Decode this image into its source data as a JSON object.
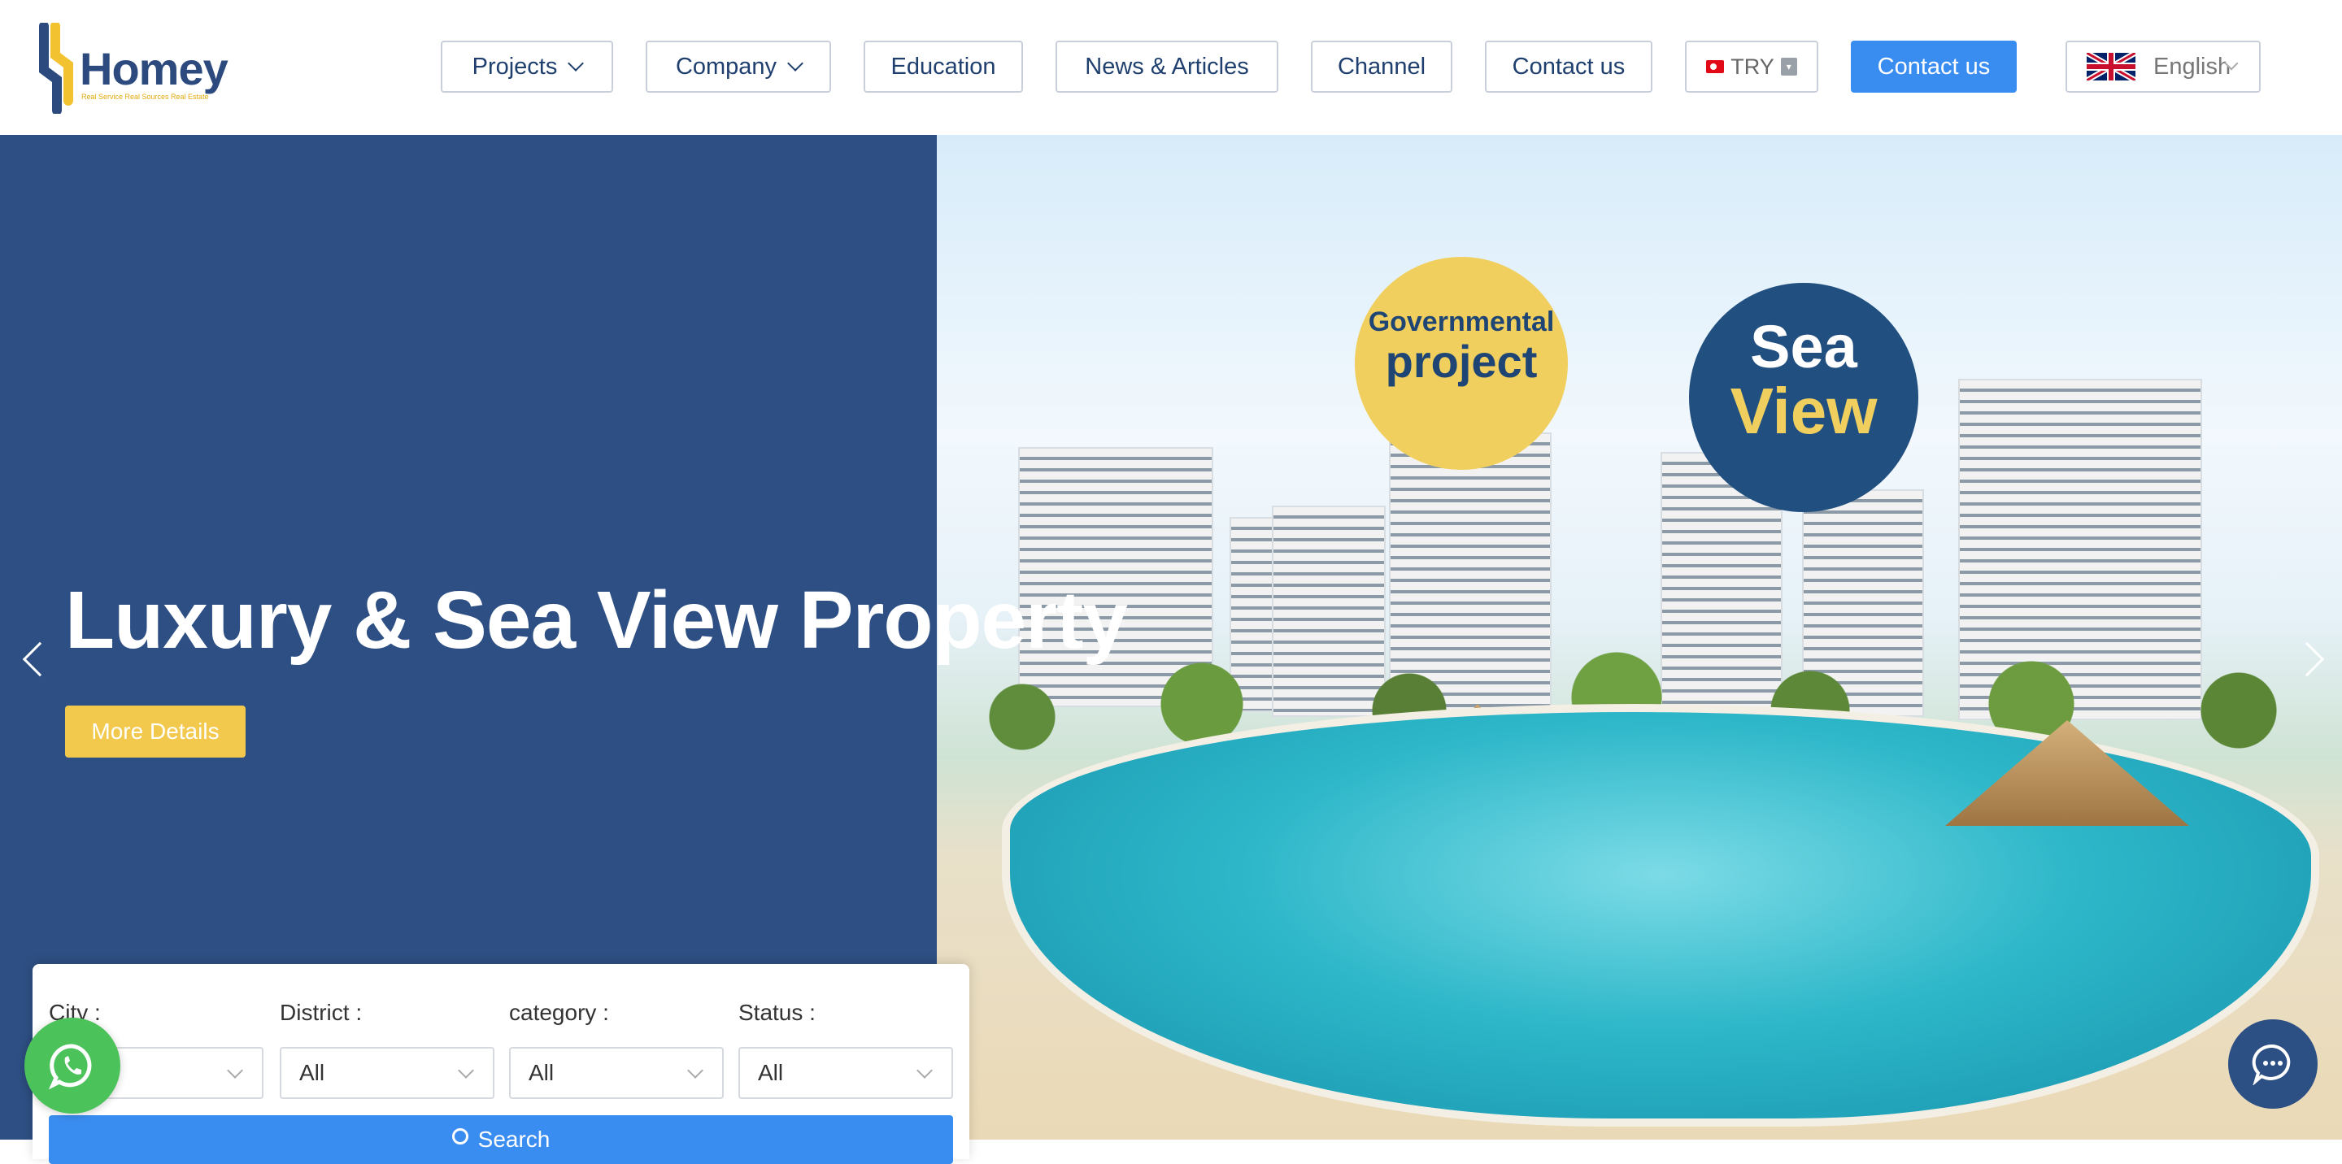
{
  "brand": {
    "name": "Homey",
    "tagline": "Real Service Real Sources Real Estate",
    "colors": {
      "navy": "#2e4f83",
      "accent_yellow": "#f2c94c",
      "primary_blue": "#3a8df0"
    }
  },
  "nav": {
    "items": [
      {
        "label": "Projects",
        "has_dropdown": true
      },
      {
        "label": "Company",
        "has_dropdown": true
      },
      {
        "label": "Education",
        "has_dropdown": false
      },
      {
        "label": "News & Articles",
        "has_dropdown": false
      },
      {
        "label": "Channel",
        "has_dropdown": false
      },
      {
        "label": "Contact us",
        "has_dropdown": false
      }
    ],
    "currency": "TRY",
    "cta": "Contact us",
    "language": "English"
  },
  "hero": {
    "title": "Luxury & Sea View Property",
    "button": "More Details",
    "badge_gov_line1": "Governmental",
    "badge_gov_line2": "project",
    "badge_sea_line1": "Sea",
    "badge_sea_line2": "View"
  },
  "search": {
    "fields": [
      {
        "label": "City :",
        "value": ""
      },
      {
        "label": "District :",
        "value": "All"
      },
      {
        "label": "category :",
        "value": "All"
      },
      {
        "label": "Status :",
        "value": "All"
      }
    ],
    "button": "Search"
  },
  "icons": {
    "whatsapp": "whatsapp-icon",
    "chat": "chat-bubble-icon",
    "prev": "chevron-left-icon",
    "next": "chevron-right-icon"
  }
}
